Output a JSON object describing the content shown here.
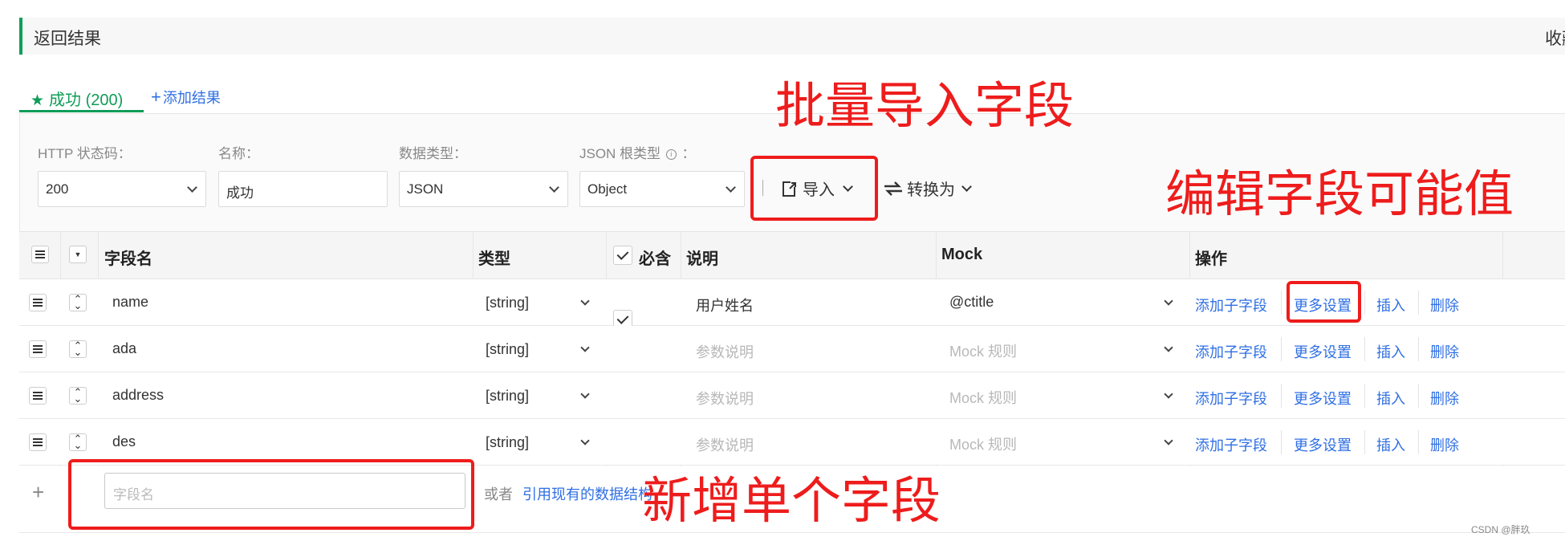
{
  "header": {
    "title": "返回结果",
    "right_text": "收藏"
  },
  "tabs": {
    "success_label": "成功 (200)",
    "add_result_label": "添加结果"
  },
  "form": {
    "http_status_label": "HTTP 状态码：",
    "http_status_value": "200",
    "name_label": "名称：",
    "name_value": "成功",
    "data_type_label": "数据类型：",
    "data_type_value": "JSON",
    "json_root_label": "JSON 根类型",
    "json_root_colon": "：",
    "json_root_value": "Object",
    "import_label": "导入",
    "convert_label": "转换为"
  },
  "table": {
    "headers": {
      "field_name": "字段名",
      "type": "类型",
      "required": "必含",
      "description": "说明",
      "mock": "Mock",
      "actions": "操作"
    },
    "rows": [
      {
        "name": "name",
        "type": "[string]",
        "required": true,
        "description": "用户姓名",
        "mock": "@ctitle"
      },
      {
        "name": "ada",
        "type": "[string]",
        "required": true,
        "description": "",
        "mock": ""
      },
      {
        "name": "address",
        "type": "[string]",
        "required": true,
        "description": "",
        "mock": ""
      },
      {
        "name": "des",
        "type": "[string]",
        "required": true,
        "description": "",
        "mock": ""
      }
    ],
    "desc_placeholder": "参数说明",
    "mock_placeholder": "Mock 规则",
    "actions": {
      "add_child": "添加子字段",
      "more_settings": "更多设置",
      "insert": "插入",
      "delete": "删除"
    }
  },
  "add_row": {
    "field_placeholder": "字段名",
    "or_text": "或者",
    "reference_link": "引用现有的数据结构"
  },
  "annotations": {
    "batch_import": "批量导入字段",
    "edit_values": "编辑字段可能值",
    "add_single": "新增单个字段"
  },
  "watermark": "CSDN @胖玖",
  "colors": {
    "accent": "#0f9d58",
    "link": "#2f6fe4",
    "annotation": "#ee1c1c"
  }
}
